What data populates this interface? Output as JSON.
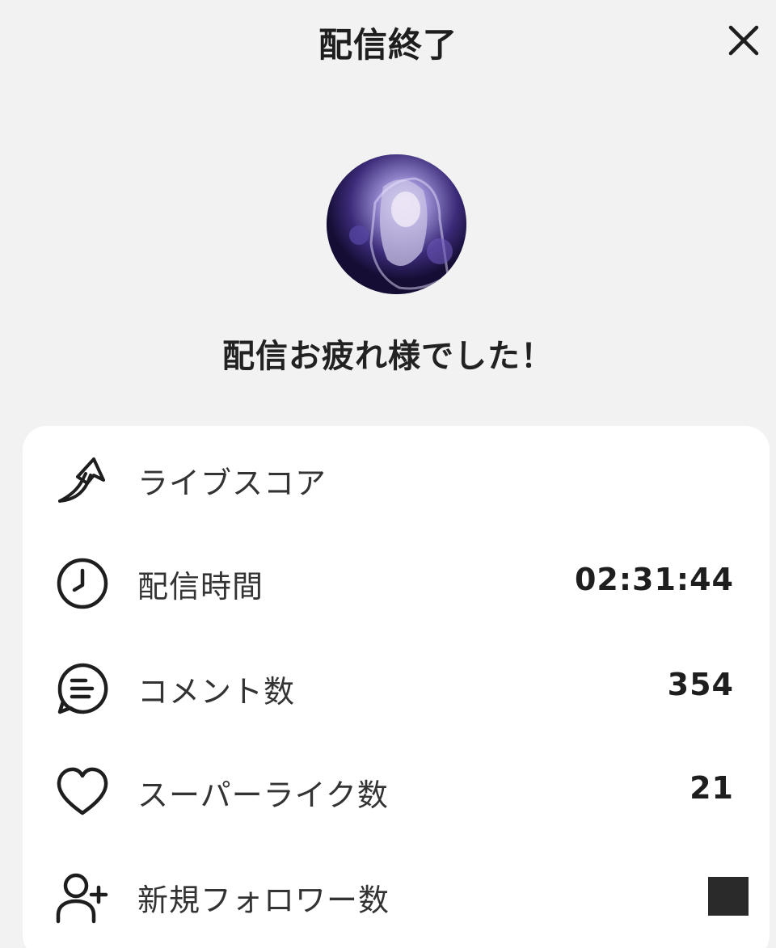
{
  "header": {
    "title": "配信終了",
    "close_icon": "close-icon"
  },
  "avatar": {
    "icon": "profile-avatar"
  },
  "message": "配信お疲れ様でした！",
  "stats": [
    {
      "label": "ライブスコア",
      "value": "",
      "icon": "upward-arrow-icon"
    },
    {
      "label": "配信時間",
      "value": "02:31:44",
      "icon": "clock-icon"
    },
    {
      "label": "コメント数",
      "value": "354",
      "icon": "comment-icon"
    },
    {
      "label": "スーパーライク数",
      "value": "21",
      "icon": "heart-icon"
    },
    {
      "label": "新規フォロワー数",
      "value": "",
      "icon": "add-user-icon"
    }
  ],
  "colors": {
    "background": "#f2f2f2",
    "card": "#ffffff",
    "text": "#222222"
  }
}
